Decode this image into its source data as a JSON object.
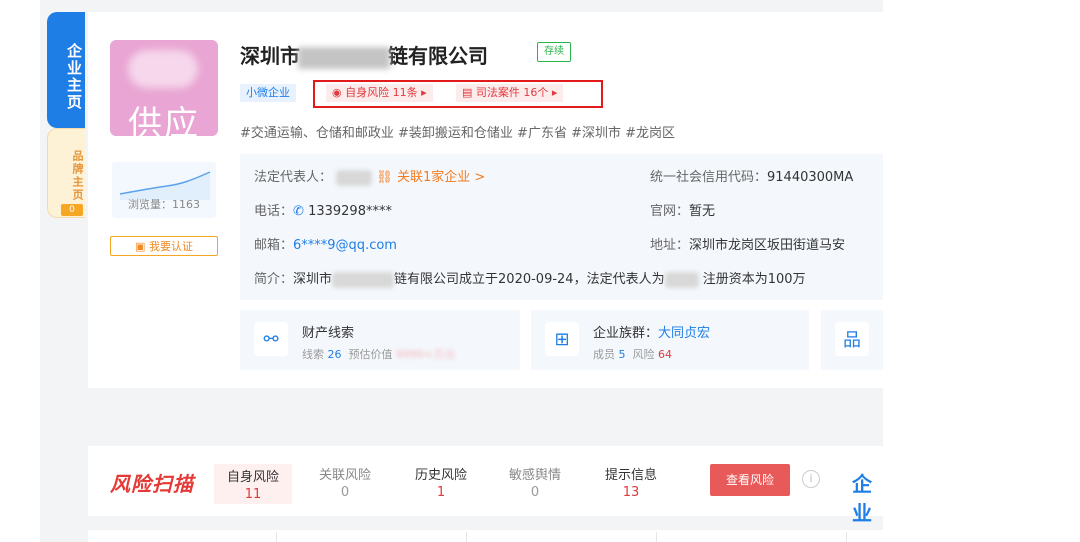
{
  "sidebar": {
    "main_tab": "企业主页",
    "brand_tab": "品牌主页",
    "brand_count": "0"
  },
  "profile": {
    "logo_text": "供应",
    "views_label": "浏览量：",
    "views_value": "1163",
    "cert_label": "我要认证"
  },
  "company": {
    "name_prefix": "深圳市",
    "name_suffix": "链有限公司",
    "status": "存续",
    "size_tag": "小微企业",
    "risk_self": "自身风险 11条",
    "risk_legal": "司法案件 16个",
    "industry": "#交通运输、仓储和邮政业  #装卸搬运和仓储业  #广东省  #深圳市  #龙岗区"
  },
  "details": {
    "legal_rep_label": "法定代表人：",
    "related_link": "关联1家企业 >",
    "credit_label": "统一社会信用代码：",
    "credit_value": "91440300MA",
    "phone_label": "电话：",
    "phone_value": "1339298****",
    "website_label": "官网：",
    "website_value": "暂无",
    "email_label": "邮箱：",
    "email_value": "6****9@qq.com",
    "address_label": "地址：",
    "address_value": "深圳市龙岗区坂田街道马安",
    "intro_label": "简介：",
    "intro_a": "深圳市",
    "intro_b": "链有限公司成立于2020-09-24，法定代表人为",
    "intro_c": "注册资本为100万"
  },
  "features": [
    {
      "title": "财产线索",
      "sub_a": "线索",
      "sub_a_val": "26",
      "sub_b": "预估价值",
      "sub_b_val": "9999+万元"
    },
    {
      "title": "企业族群：",
      "title_link": "大同贞宏",
      "sub_a": "成员",
      "sub_a_val": "5",
      "sub_b": "风险",
      "sub_b_val": "64"
    }
  ],
  "risk_scan": {
    "title": "风险扫描",
    "tabs": [
      {
        "label": "自身风险",
        "value": "11"
      },
      {
        "label": "关联风险",
        "value": "0"
      },
      {
        "label": "历史风险",
        "value": "1"
      },
      {
        "label": "敏感舆情",
        "value": "0"
      },
      {
        "label": "提示信息",
        "value": "13"
      }
    ],
    "view_button": "查看风险",
    "info_icon": "i",
    "next_label": "企业"
  },
  "colors": {
    "accent": "#1f7ee6",
    "risk": "#e0393e",
    "brand": "#f5a623"
  }
}
